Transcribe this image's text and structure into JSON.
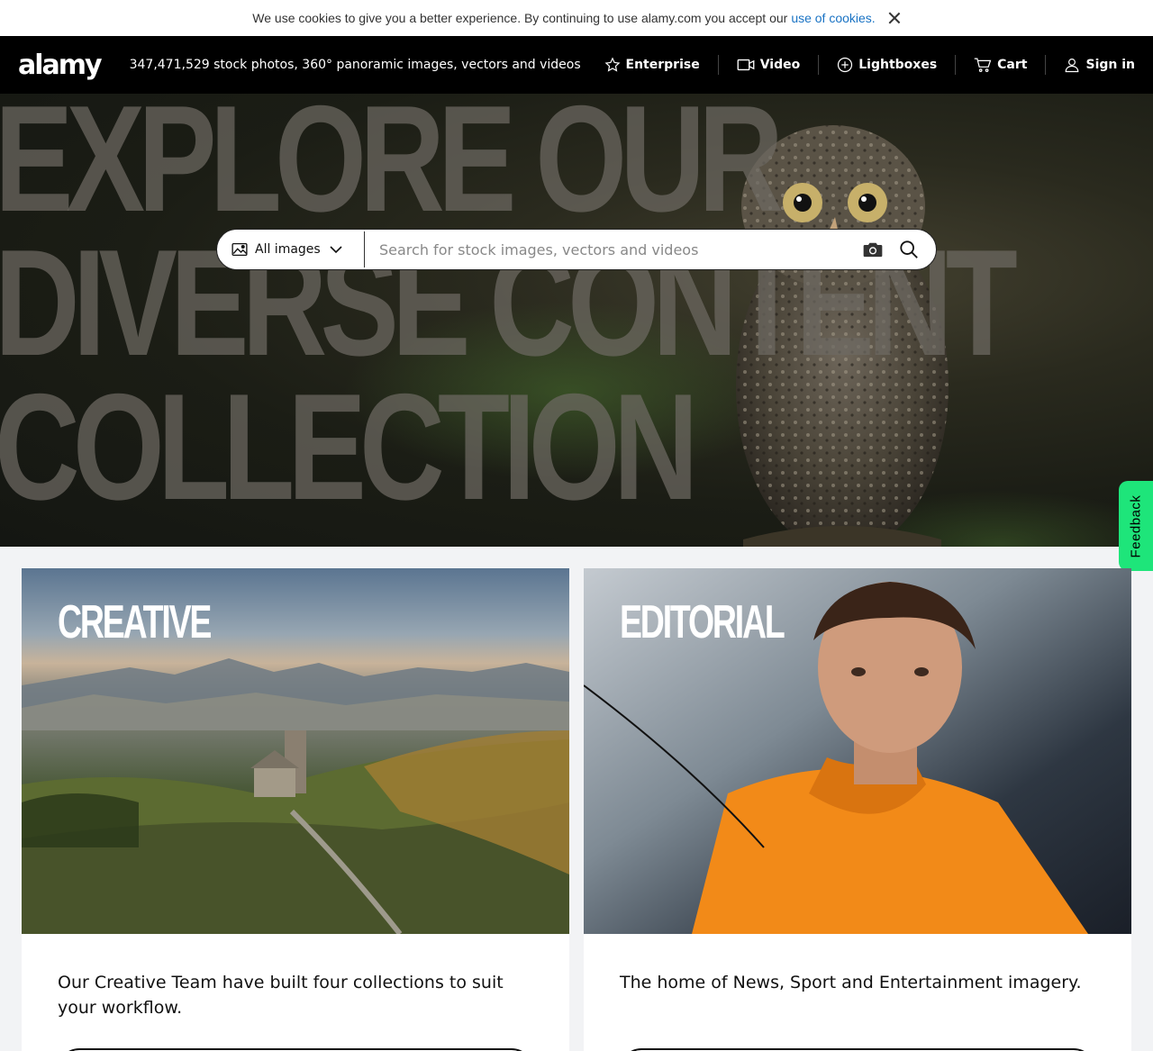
{
  "cookie_bar": {
    "message": "We use cookies to give you a better experience. By continuing to use alamy.com you accept our",
    "link_text": "use of cookies."
  },
  "header": {
    "logo": "alamy",
    "tagline": "347,471,529 stock photos, 360° panoramic images, vectors and videos",
    "nav": [
      {
        "label": "Enterprise",
        "icon": "star-icon"
      },
      {
        "label": "Video",
        "icon": "video-icon"
      },
      {
        "label": "Lightboxes",
        "icon": "plus-circle-icon"
      },
      {
        "label": "Cart",
        "icon": "cart-icon"
      },
      {
        "label": "Sign in",
        "icon": "user-icon"
      }
    ]
  },
  "hero": {
    "headline_lines": [
      "EXPLORE OUR",
      "DIVERSE CONTENT",
      "COLLECTION"
    ],
    "search": {
      "type_label": "All images",
      "placeholder": "Search for stock images, vectors and videos"
    }
  },
  "feedback_label": "Feedback",
  "cards": [
    {
      "label": "CREATIVE",
      "description": "Our Creative Team have built four collections to suit your workflow."
    },
    {
      "label": "EDITORIAL",
      "description": "The home of News, Sport and Entertainment imagery."
    }
  ],
  "colors": {
    "header_bg": "#000000",
    "link": "#1a73c4",
    "feedback": "#1ee57a"
  }
}
